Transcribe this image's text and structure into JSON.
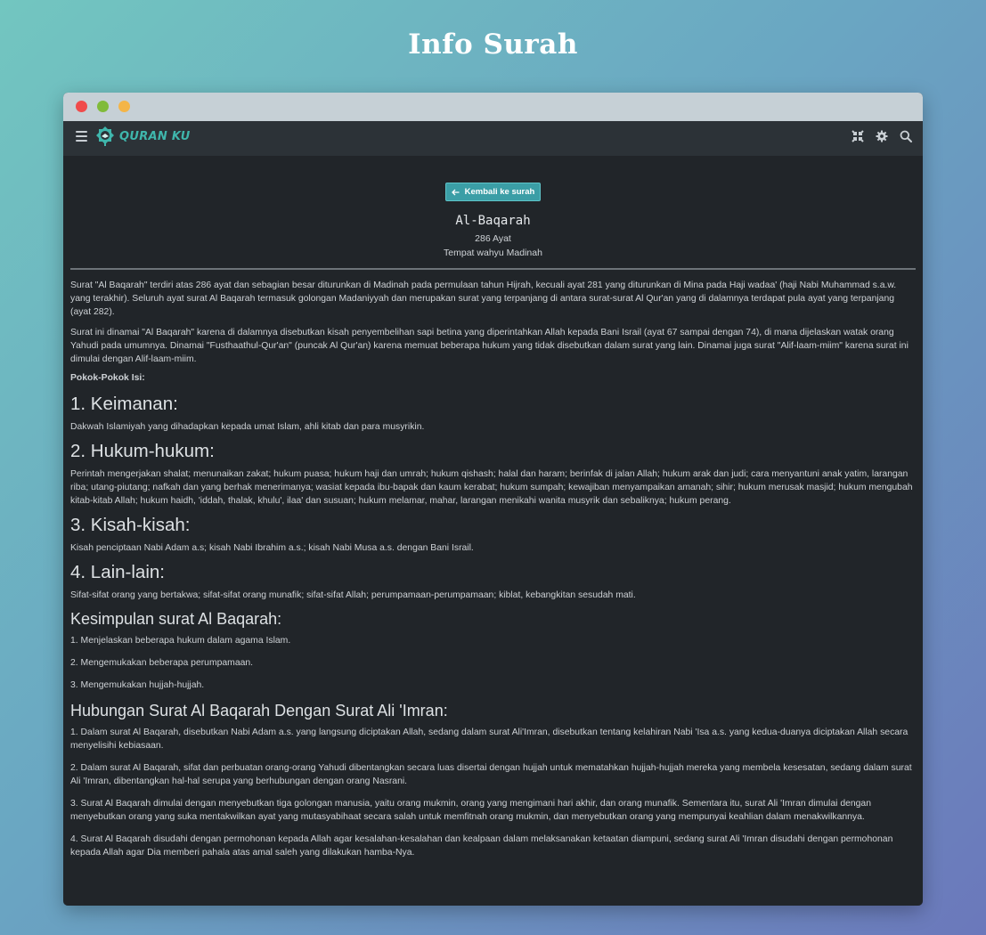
{
  "page_title": "Info Surah",
  "navbar": {
    "brand": "QURAN KU",
    "icons": [
      "menu-icon",
      "compress-icon",
      "gear-icon",
      "search-icon"
    ]
  },
  "colors": {
    "accent": "#3b9ea6",
    "background": "#212529",
    "navbar": "#2c3237"
  },
  "back_button": {
    "label": "Kembali ke surah",
    "icon": "arrow-left-icon"
  },
  "surah": {
    "name": "Al-Baqarah",
    "ayat": "286 Ayat",
    "place": "Tempat wahyu Madinah"
  },
  "intro": [
    "Surat \"Al Baqarah\" terdiri atas 286 ayat dan sebagian besar diturunkan di Madinah pada permulaan tahun Hijrah, kecuali ayat 281 yang diturunkan di Mina pada Haji wadaa' (haji Nabi Muhammad s.a.w. yang terakhir). Seluruh ayat surat Al Baqarah termasuk golongan Madaniyyah dan merupakan surat yang terpanjang di antara surat-surat Al Qur'an yang di dalamnya terdapat pula ayat yang terpanjang (ayat 282).",
    "Surat ini dinamai \"Al Baqarah\" karena di dalamnya disebutkan kisah penyembelihan sapi betina yang diperintahkan Allah kepada Bani Israil (ayat 67 sampai dengan 74), di mana dijelaskan watak orang Yahudi pada umumnya. Dinamai \"Fusthaathul-Qur'an\" (puncak Al Qur'an) karena memuat beberapa hukum yang tidak disebutkan dalam surat yang lain. Dinamai juga surat \"Alif-laam-miim\" karena surat ini dimulai dengan Alif-laam-miim."
  ],
  "pokok_label": "Pokok-Pokok Isi:",
  "sections": [
    {
      "title": "1. Keimanan:",
      "text": "Dakwah Islamiyah yang dihadapkan kepada umat Islam, ahli kitab dan para musyrikin."
    },
    {
      "title": "2. Hukum-hukum:",
      "text": "Perintah mengerjakan shalat; menunaikan zakat; hukum puasa; hukum haji dan umrah; hukum qishash; halal dan haram; berinfak di jalan Allah; hukum arak dan judi; cara menyantuni anak yatim, larangan riba; utang-piutang; nafkah dan yang berhak menerimanya; wasiat kepada ibu-bapak dan kaum kerabat; hukum sumpah; kewajiban menyampaikan amanah; sihir; hukum merusak masjid; hukum mengubah kitab-kitab Allah; hukum haidh, 'iddah, thalak, khulu', ilaa' dan susuan; hukum melamar, mahar, larangan menikahi wanita musyrik dan sebaliknya; hukum perang."
    },
    {
      "title": "3. Kisah-kisah:",
      "text": "Kisah penciptaan Nabi Adam a.s; kisah Nabi Ibrahim a.s.; kisah Nabi Musa a.s. dengan Bani Israil."
    },
    {
      "title": "4. Lain-lain:",
      "text": "Sifat-sifat orang yang bertakwa; sifat-sifat orang munafik; sifat-sifat Allah; perumpamaan-perumpamaan; kiblat, kebangkitan sesudah mati."
    }
  ],
  "kesimpulan": {
    "title": "Kesimpulan surat Al Baqarah:",
    "items": [
      "1. Menjelaskan beberapa hukum dalam agama Islam.",
      "2. Mengemukakan beberapa perumpamaan.",
      "3. Mengemukakan hujjah-hujjah."
    ]
  },
  "hubungan": {
    "title": "Hubungan Surat Al Baqarah Dengan Surat Ali 'Imran:",
    "items": [
      "1. Dalam surat Al Baqarah, disebutkan Nabi Adam a.s. yang langsung diciptakan Allah, sedang dalam surat Ali'Imran, disebutkan tentang kelahiran Nabi 'Isa a.s. yang kedua-duanya diciptakan Allah secara menyelisihi kebiasaan.",
      "2. Dalam surat Al Baqarah, sifat dan perbuatan orang-orang Yahudi dibentangkan secara luas disertai dengan hujjah untuk mematahkan hujjah-hujjah mereka yang membela kesesatan, sedang dalam surat Ali 'Imran, dibentangkan hal-hal serupa yang berhubungan dengan orang Nasrani.",
      "3. Surat Al Baqarah dimulai dengan menyebutkan tiga golongan manusia, yaitu orang mukmin, orang yang mengimani hari akhir, dan orang munafik. Sementara itu, surat Ali 'Imran dimulai dengan menyebutkan orang yang suka mentakwilkan ayat yang mutasyabihaat secara salah untuk memfitnah orang mukmin, dan menyebutkan orang yang mempunyai keahlian dalam menakwilkannya.",
      "4. Surat Al Baqarah disudahi dengan permohonan kepada Allah agar kesalahan-kesalahan dan kealpaan dalam melaksanakan ketaatan diampuni, sedang surat Ali 'Imran disudahi dengan permohonan kepada Allah agar Dia memberi pahala atas amal saleh yang dilakukan hamba-Nya."
    ]
  }
}
